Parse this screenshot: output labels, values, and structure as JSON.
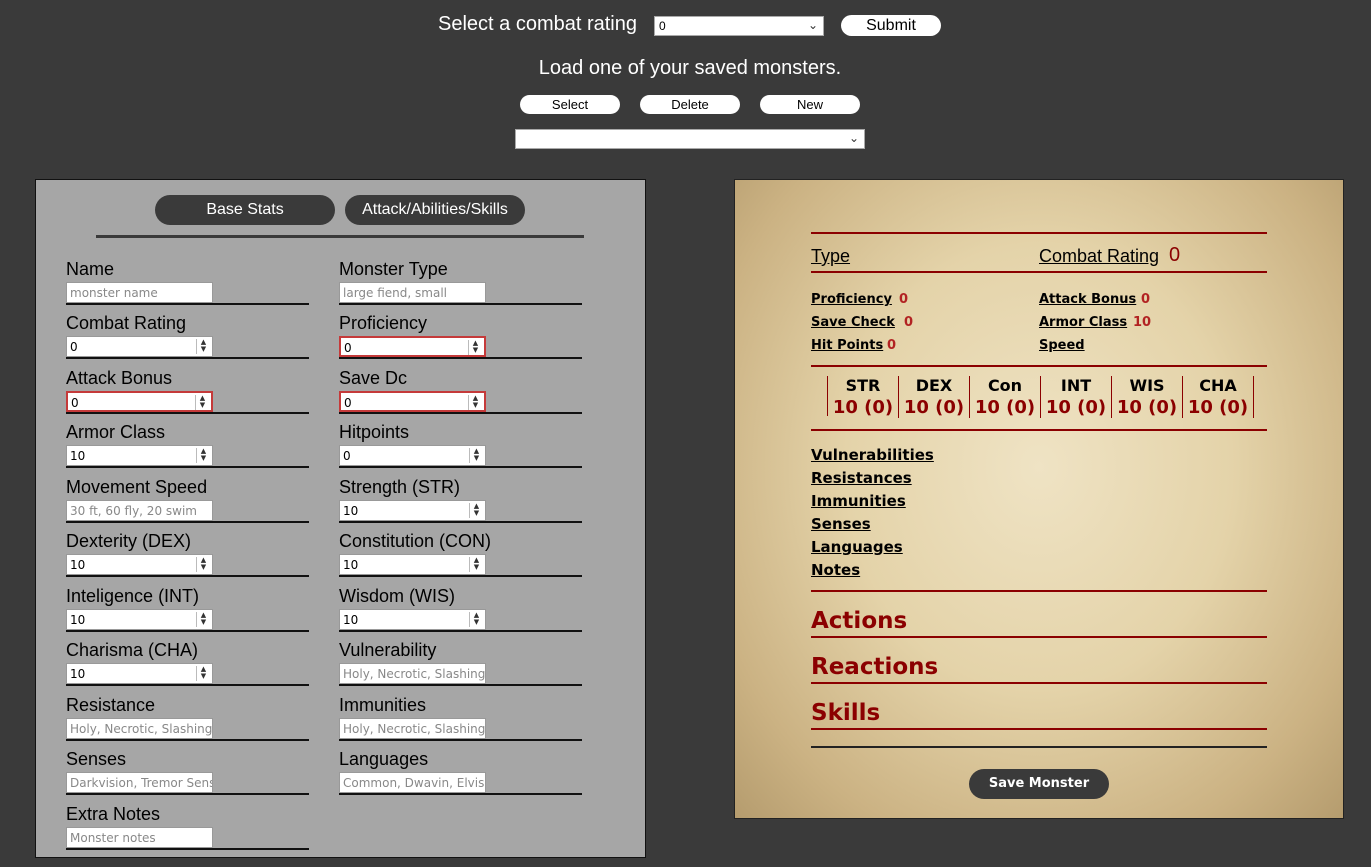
{
  "top": {
    "combat_rating_label": "Select a combat rating",
    "combat_rating_value": "0",
    "submit_label": "Submit",
    "load_label": "Load one of your saved monsters.",
    "select_label": "Select",
    "delete_label": "Delete",
    "new_label": "New",
    "saved_monster_value": ""
  },
  "form": {
    "tabs": [
      "Base Stats",
      "Attack/Abilities/Skills"
    ],
    "fields": [
      {
        "label": "Name",
        "placeholder": "monster name",
        "value": ""
      },
      {
        "label": "Monster Type",
        "placeholder": "large fiend, small",
        "value": ""
      },
      {
        "label": "Combat Rating",
        "value": "0"
      },
      {
        "label": "Proficiency",
        "value": "0"
      },
      {
        "label": "Attack Bonus",
        "value": "0"
      },
      {
        "label": "Save Dc",
        "value": "0"
      },
      {
        "label": "Armor Class",
        "value": "10"
      },
      {
        "label": "Hitpoints",
        "value": "0"
      },
      {
        "label": "Movement Speed",
        "placeholder": "30 ft, 60 fly, 20 swim",
        "value": ""
      },
      {
        "label": "Strength (STR)",
        "value": "10"
      },
      {
        "label": "Dexterity (DEX)",
        "value": "10"
      },
      {
        "label": "Constitution (CON)",
        "value": "10"
      },
      {
        "label": "Inteligence (INT)",
        "value": "10"
      },
      {
        "label": "Wisdom (WIS)",
        "value": "10"
      },
      {
        "label": "Charisma (CHA)",
        "value": "10"
      },
      {
        "label": "Vulnerability",
        "placeholder": "Holy, Necrotic, Slashing",
        "value": ""
      },
      {
        "label": "Resistance",
        "placeholder": "Holy, Necrotic, Slashing",
        "value": ""
      },
      {
        "label": "Immunities",
        "placeholder": "Holy, Necrotic, Slashing",
        "value": ""
      },
      {
        "label": "Senses",
        "placeholder": "Darkvision, Tremor Sense",
        "value": ""
      },
      {
        "label": "Languages",
        "placeholder": "Common, Dwavin, Elvish",
        "value": ""
      },
      {
        "label": "Extra Notes",
        "placeholder": "Monster notes",
        "value": ""
      }
    ]
  },
  "sheet": {
    "type_label": "Type",
    "cr_label": "Combat Rating",
    "cr_value": "0",
    "proficiency_label": "Proficiency",
    "proficiency_value": "0",
    "attack_bonus_label": "Attack Bonus",
    "attack_bonus_value": "0",
    "save_check_label": "Save Check",
    "save_check_value": "0",
    "armor_class_label": "Armor Class",
    "armor_class_value": "10",
    "hit_points_label": "Hit Points",
    "hit_points_value": "0",
    "speed_label": "Speed",
    "abilities": [
      {
        "name": "STR",
        "value": "10 (0)"
      },
      {
        "name": "DEX",
        "value": "10 (0)"
      },
      {
        "name": "Con",
        "value": "10 (0)"
      },
      {
        "name": "INT",
        "value": "10 (0)"
      },
      {
        "name": "WIS",
        "value": "10 (0)"
      },
      {
        "name": "CHA",
        "value": "10 (0)"
      }
    ],
    "traits": [
      "Vulnerabilities",
      "Resistances",
      "Immunities",
      "Senses",
      "Languages",
      "Notes"
    ],
    "sections": [
      "Actions",
      "Reactions",
      "Skills"
    ],
    "save_label": "Save Monster"
  }
}
